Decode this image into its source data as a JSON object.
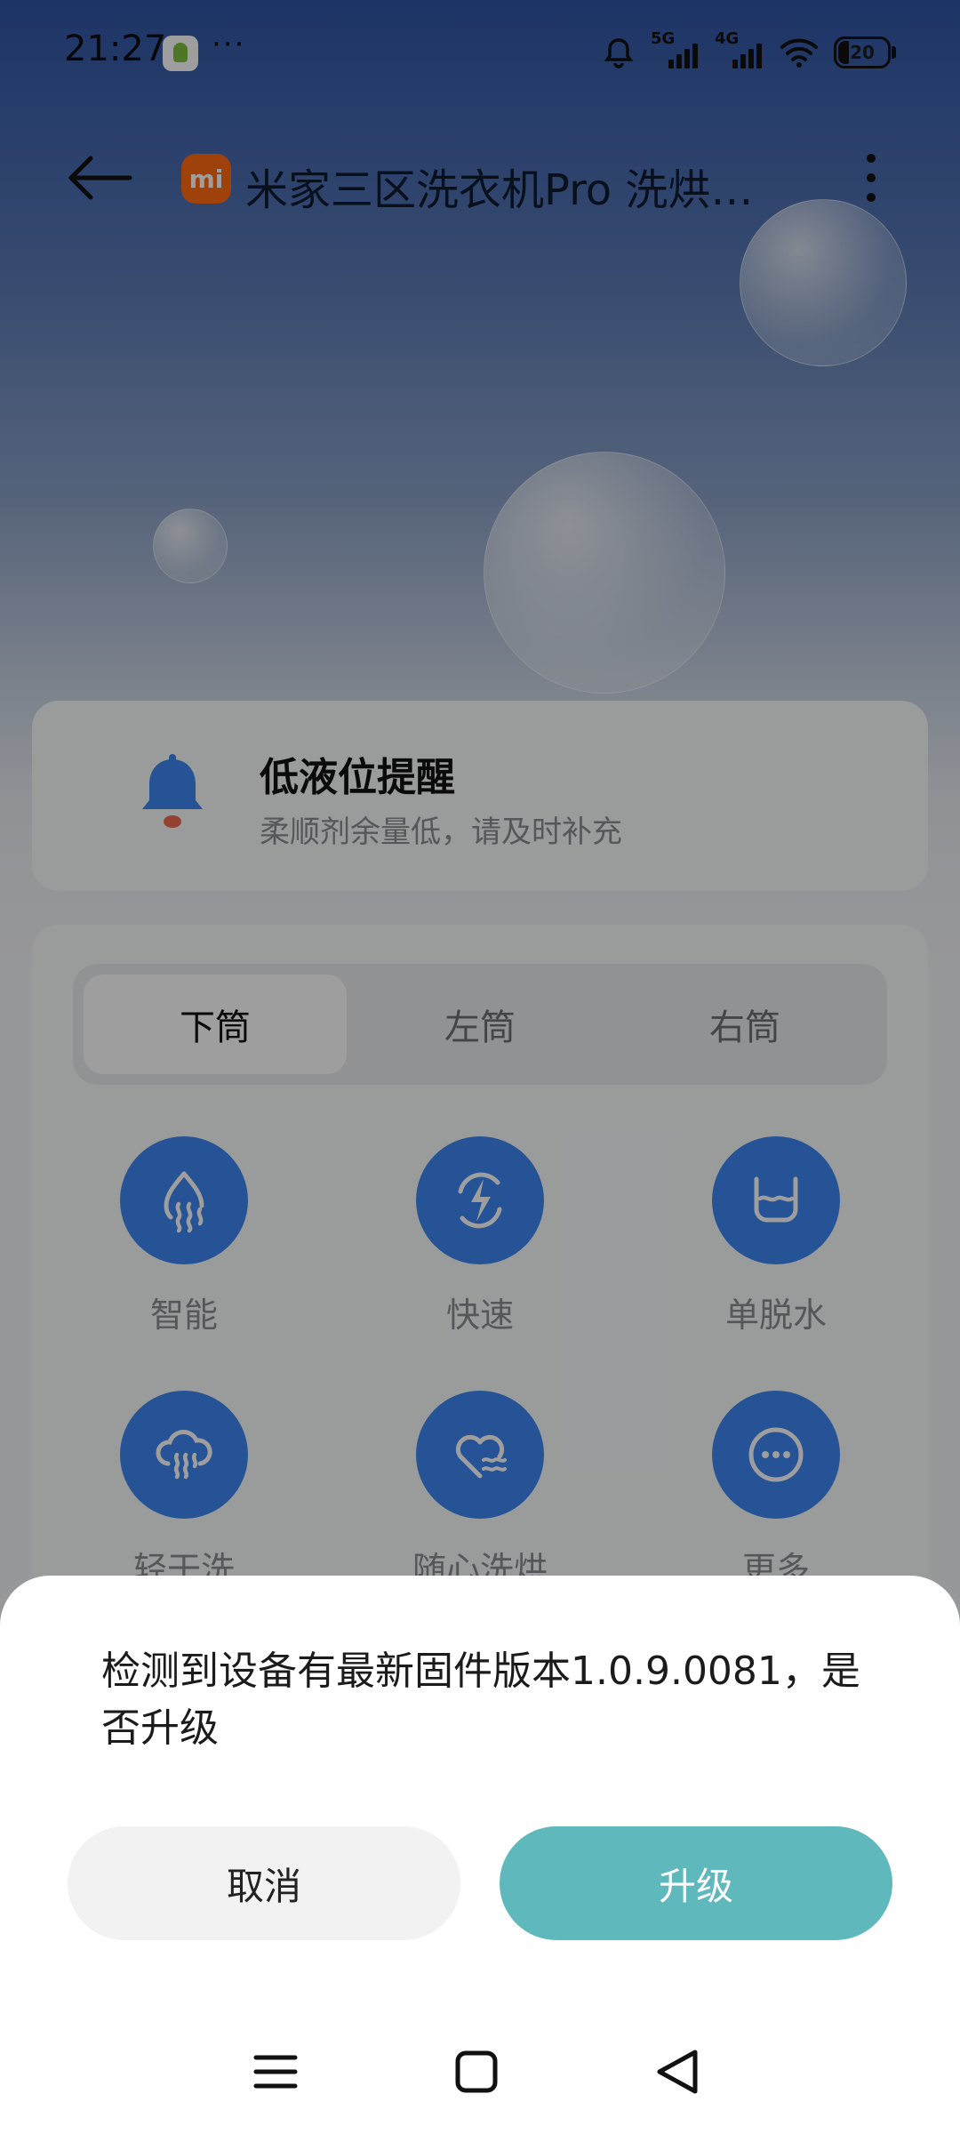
{
  "status_bar": {
    "time": "21:27",
    "more": "···",
    "signal_5g": "5G",
    "signal_4g": "4G",
    "battery": "20"
  },
  "header": {
    "title": "米家三区洗衣机Pro 洗烘…",
    "brand_icon_text": "mi",
    "back_icon": "back-arrow-icon",
    "more_icon": "more-vertical-icon"
  },
  "alert": {
    "icon": "bell-icon",
    "title": "低液位提醒",
    "subtitle": "柔顺剂余量低，请及时补充"
  },
  "drum_tabs": [
    {
      "label": "下筒",
      "active": true
    },
    {
      "label": "左筒",
      "active": false
    },
    {
      "label": "右筒",
      "active": false
    }
  ],
  "modes": [
    {
      "label": "智能",
      "icon": "steam-drop-icon"
    },
    {
      "label": "快速",
      "icon": "lightning-icon"
    },
    {
      "label": "单脱水",
      "icon": "basin-icon"
    },
    {
      "label": "轻干洗",
      "icon": "cloud-steam-icon"
    },
    {
      "label": "随心洗烘",
      "icon": "heart-wave-icon"
    },
    {
      "label": "更多",
      "icon": "more-dots-icon"
    }
  ],
  "dialog": {
    "message": "检测到设备有最新固件版本1.0.9.0081，是否升级",
    "cancel_label": "取消",
    "confirm_label": "升级"
  },
  "nav": {
    "menu_icon": "menu-icon",
    "home_icon": "home-square-icon",
    "back_icon": "back-triangle-icon"
  },
  "colors": {
    "header_gradient_top": "#2f55a6",
    "mode_circle": "#3d86f0",
    "upgrade_button": "#5fb8bc",
    "brand_orange": "#ff6a13"
  }
}
